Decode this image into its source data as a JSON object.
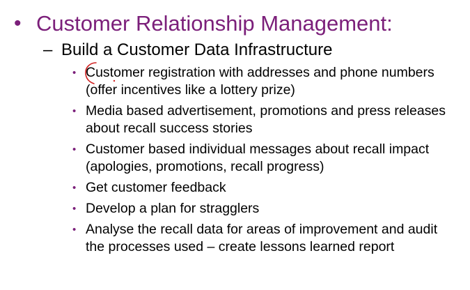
{
  "slide": {
    "heading": "Customer Relationship Management:",
    "heading_bullet": "•",
    "subheading_dash": "–",
    "subheading": "Build a Customer Data Infrastructure",
    "bullet_glyph": "•",
    "items": [
      {
        "text": "Customer registration with addresses and phone numbers (offer incentives like a lottery prize)"
      },
      {
        "text": "Media based advertisement, promotions and press releases about recall success stories"
      },
      {
        "text": "Customer based individual messages about recall impact (apologies, promotions, recall progress)"
      },
      {
        "text": "Get customer feedback"
      },
      {
        "text": "Develop a plan for stragglers"
      },
      {
        "text": "Analyse the recall data for areas of improvement and audit the processes used – create lessons learned report"
      }
    ]
  },
  "colors": {
    "heading": "#7b1f7a",
    "body_text": "#000000",
    "annotation_ink": "#d02020",
    "background": "#ffffff"
  }
}
